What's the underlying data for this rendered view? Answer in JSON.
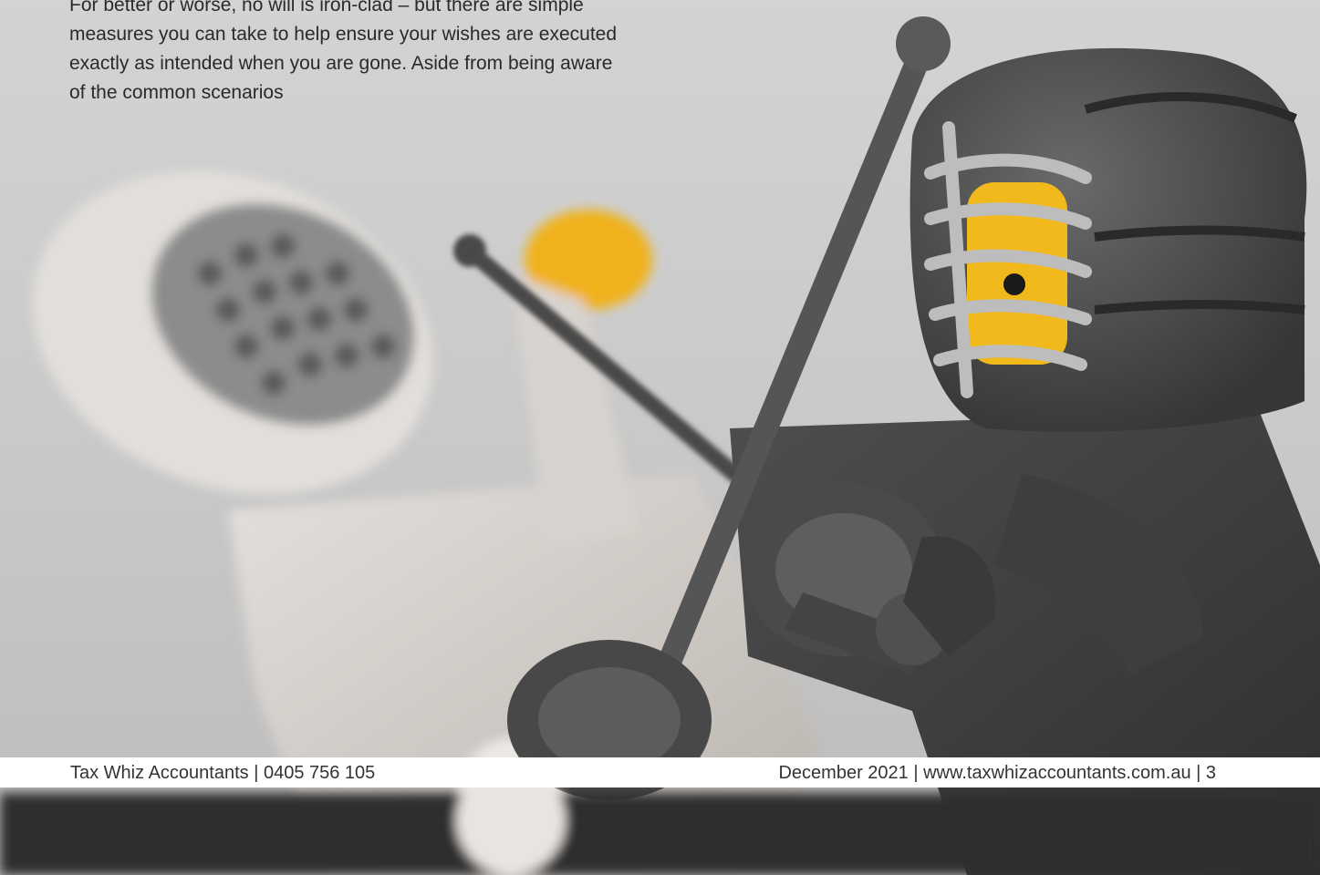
{
  "article": {
    "intro_text": "For better or worse, no will is iron-clad – but there are simple measures you can take to help ensure your wishes are executed exactly as intended when you are gone. Aside from being aware of the common scenarios"
  },
  "footer": {
    "left": "Tax Whiz Accountants | 0405 756 105",
    "right": "December 2021 | www.taxwhizaccountants.com.au | 3"
  },
  "image": {
    "subject": "two toy minifigures fencing",
    "colors": {
      "background": "#cfcfcf",
      "dark_figure": "#4a4a4a",
      "light_figure": "#d9d4cf",
      "face": "#f2b91c"
    }
  }
}
